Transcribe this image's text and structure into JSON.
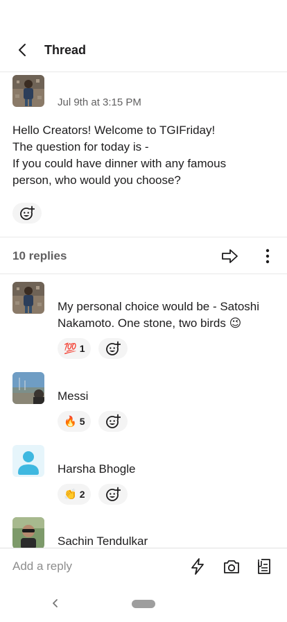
{
  "header": {
    "title": "Thread"
  },
  "parent_message": {
    "timestamp": "Jul 9th at 3:15 PM",
    "lines": [
      "Hello Creators! Welcome to TGIFriday!",
      "The question for today is -",
      "If you could have dinner with any famous",
      "person, who would you choose?"
    ]
  },
  "replies_bar": {
    "count_label": "10 replies"
  },
  "replies": [
    {
      "author": "",
      "lines": [
        "My personal choice would be - Satoshi",
        "Nakamoto. One stone, two birds 😉"
      ],
      "reaction": {
        "emoji": "💯",
        "count": "1"
      }
    },
    {
      "author": "Messi",
      "lines": [],
      "reaction": {
        "emoji": "🔥",
        "count": "5"
      }
    },
    {
      "author": "Harsha Bhogle",
      "lines": [],
      "reaction": {
        "emoji": "👏",
        "count": "2"
      }
    },
    {
      "author": "Sachin Tendulkar",
      "lines": [],
      "reaction": null
    }
  ],
  "composer": {
    "placeholder": "Add a reply"
  },
  "icons": {
    "back": "chevron-left-icon",
    "share": "arrow-right-icon",
    "more": "more-vertical-icon",
    "add_reaction": "add-emoji-icon",
    "shortcuts": "lightning-icon",
    "camera": "camera-icon",
    "attach": "document-icon"
  },
  "colors": {
    "text": "#1d1c1d",
    "muted": "#616061",
    "reaction_bg": "#f4f4f4",
    "default_avatar": "#3fb8e0"
  }
}
